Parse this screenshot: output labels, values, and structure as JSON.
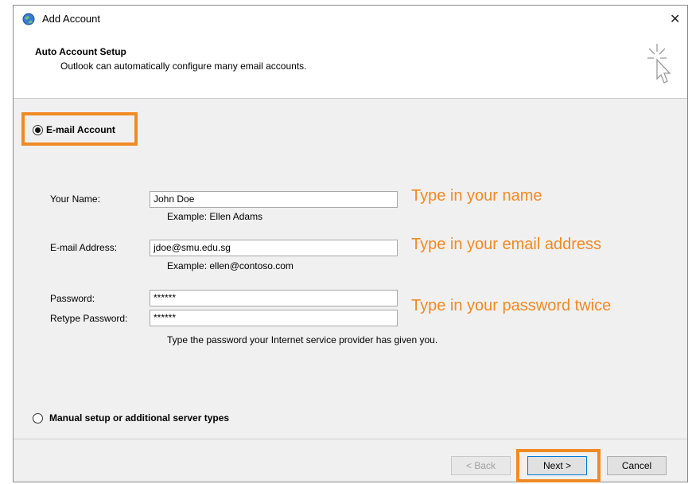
{
  "window": {
    "title": "Add Account",
    "close_glyph": "✕"
  },
  "header": {
    "title": "Auto Account Setup",
    "subtitle": "Outlook can automatically configure many email accounts."
  },
  "options": {
    "email_account": {
      "label": "E-mail Account",
      "selected": true
    },
    "manual_setup": {
      "label": "Manual setup or additional server types",
      "selected": false
    }
  },
  "form": {
    "name": {
      "label": "Your Name:",
      "value": "John Doe",
      "example": "Example: Ellen Adams"
    },
    "email": {
      "label": "E-mail Address:",
      "value": "jdoe@smu.edu.sg",
      "example": "Example: ellen@contoso.com"
    },
    "password": {
      "label": "Password:",
      "value": "******"
    },
    "retype_password": {
      "label": "Retype Password:",
      "value": "******"
    },
    "password_note": "Type the password your Internet service provider has given you."
  },
  "annotations": {
    "name_hint": "Type in your name",
    "email_hint": "Type in your email address",
    "password_hint": "Type in your password twice"
  },
  "buttons": {
    "back": "< Back",
    "next": "Next >",
    "cancel": "Cancel"
  },
  "colors": {
    "highlight": "#f08a24",
    "content_bg": "#f0f0f0",
    "default_button_border": "#0078d7"
  },
  "icons": {
    "app": "outlook-globe-icon",
    "setup": "cursor-click-icon",
    "close": "close-icon"
  }
}
